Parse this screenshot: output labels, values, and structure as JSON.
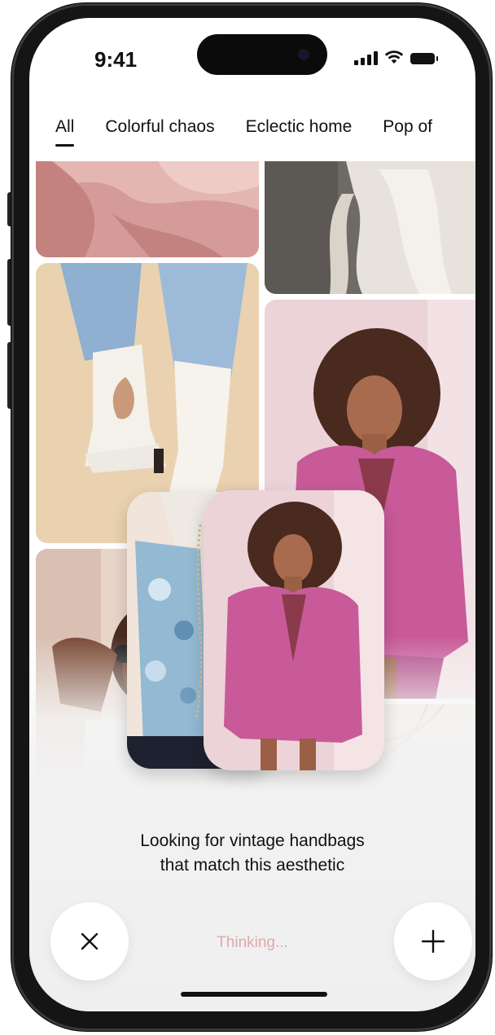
{
  "status_bar": {
    "time": "9:41"
  },
  "tabs": [
    {
      "label": "All",
      "active": true
    },
    {
      "label": "Colorful chaos",
      "active": false
    },
    {
      "label": "Eclectic home",
      "active": false
    },
    {
      "label": "Pop of",
      "active": false
    }
  ],
  "prompt": {
    "line1": "Looking for vintage handbags",
    "line2": "that match this aesthetic"
  },
  "thinking_label": "Thinking...",
  "buttons": {
    "close_icon": "close-icon",
    "add_icon": "plus-icon"
  },
  "colors": {
    "accent_pink": "#c85a9a",
    "thinking_text": "#e3a6ad"
  }
}
